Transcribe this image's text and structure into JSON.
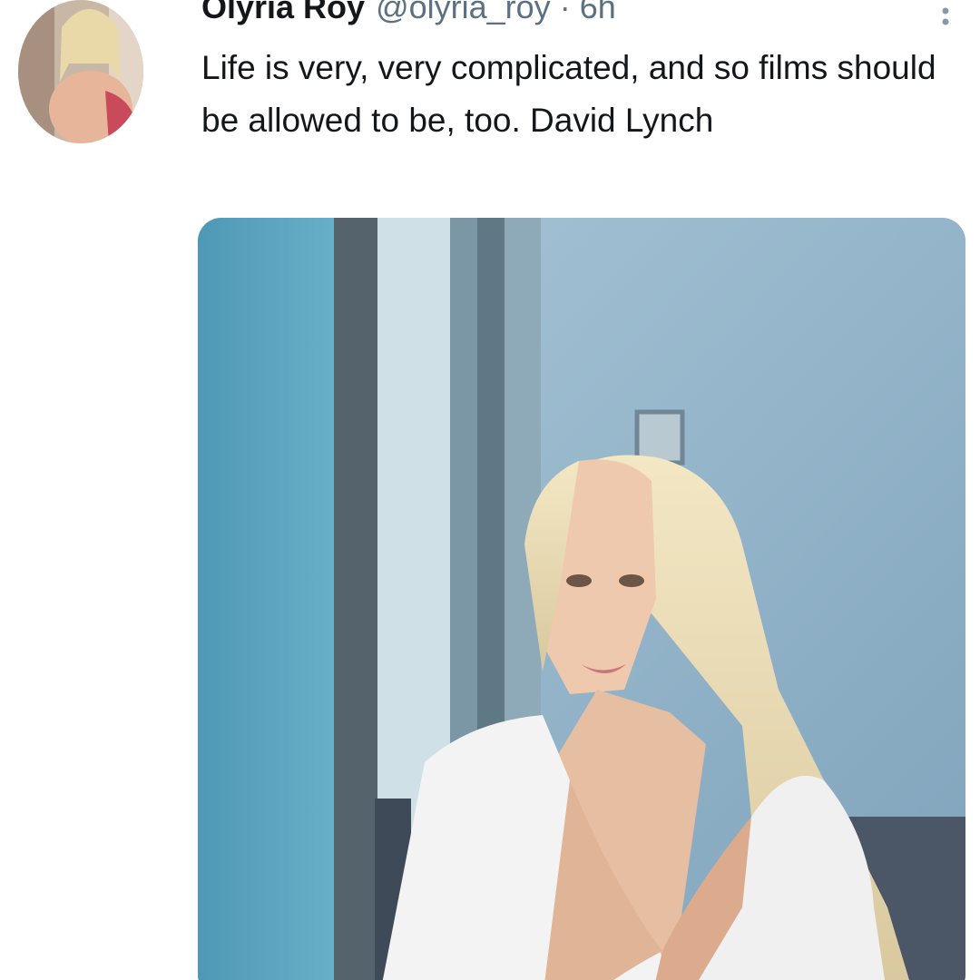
{
  "tweet": {
    "author_name": "Olyria Roy",
    "author_handle": "@olyria_roy",
    "separator": "·",
    "timestamp": "6h",
    "text": "Life is very, very complicated, and so films should be allowed to be, too. David Lynch",
    "more_icon": "more-vertical-icon",
    "media_description": "photo"
  },
  "colors": {
    "text_primary": "#14171a",
    "text_secondary": "#5b7083",
    "background": "#ffffff"
  }
}
